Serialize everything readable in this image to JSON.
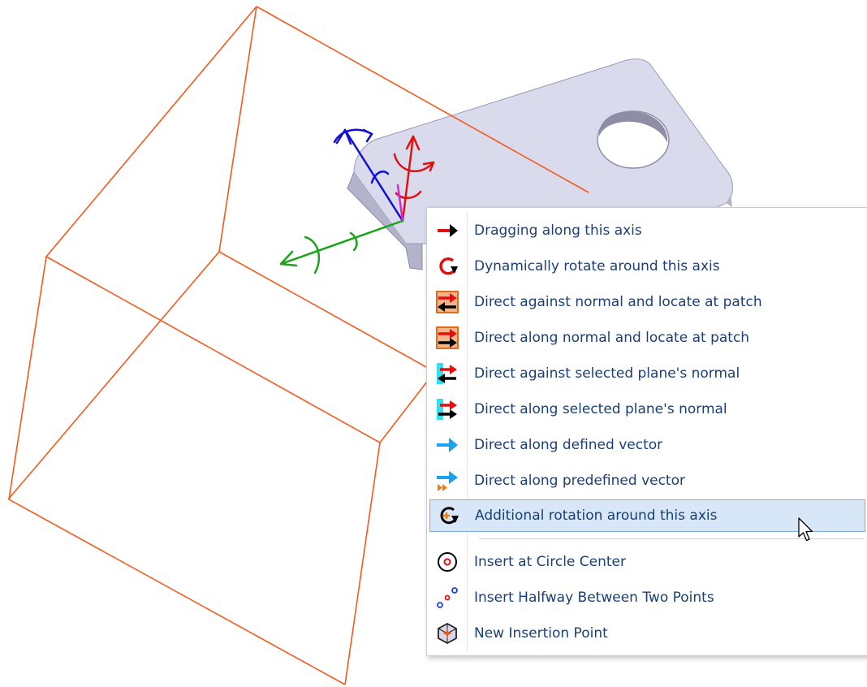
{
  "menu": {
    "items": [
      {
        "icon": "red-arrow-right-icon",
        "label": "Dragging along this axis"
      },
      {
        "icon": "rotate-arrow-icon",
        "label": "Dynamically rotate around this axis"
      },
      {
        "icon": "against-normal-patch-icon",
        "label": "Direct against normal and locate at patch"
      },
      {
        "icon": "along-normal-patch-icon",
        "label": "Direct along normal and locate at patch"
      },
      {
        "icon": "against-plane-normal-icon",
        "label": "Direct against selected plane's normal"
      },
      {
        "icon": "along-plane-normal-icon",
        "label": "Direct along selected plane's normal"
      },
      {
        "icon": "blue-arrow-right-icon",
        "label": "Direct along defined vector"
      },
      {
        "icon": "predefined-vector-icon",
        "label": "Direct along predefined vector"
      },
      {
        "icon": "additional-rotation-icon",
        "label": "Additional rotation around this axis"
      }
    ],
    "insert_items": [
      {
        "icon": "circle-center-icon",
        "label": "Insert at Circle Center"
      },
      {
        "icon": "halfway-points-icon",
        "label": "Insert Halfway Between Two Points"
      },
      {
        "icon": "new-insertion-point-icon",
        "label": "New Insertion Point"
      }
    ],
    "hover_index": 8
  },
  "colors": {
    "wireframe": "#f25a1e",
    "part_face": "#d9d9ec",
    "axis_red": "#e01010",
    "axis_blue": "#1010d8",
    "axis_green": "#1aa31a",
    "axis_magenta": "#d428d4",
    "menu_hover": "#d7e7f7",
    "menu_text": "#1c3f75"
  }
}
